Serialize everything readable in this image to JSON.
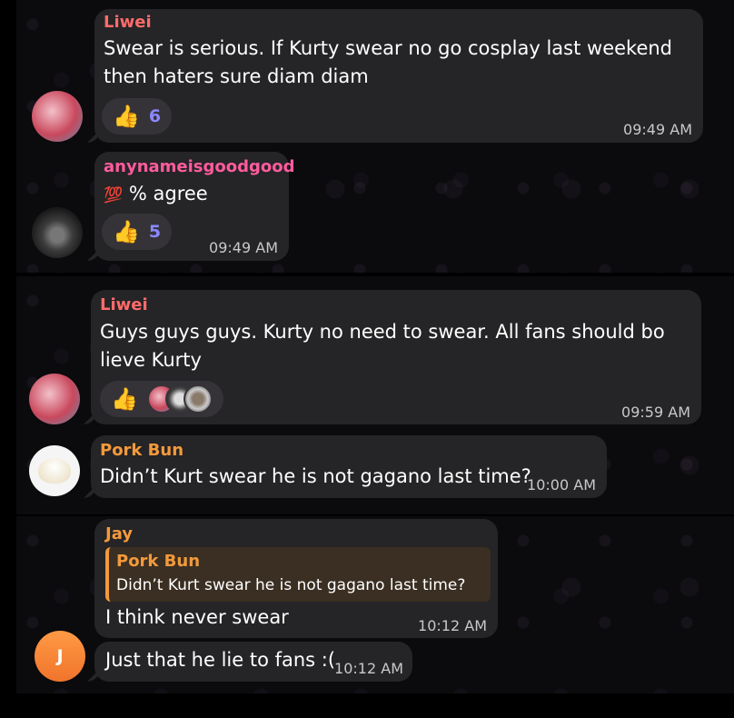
{
  "colors": {
    "liwei": "#ff6b6b",
    "anyname": "#ff5c9e",
    "porkbun": "#f39a3c",
    "jay": "#f39a3c",
    "count": "#8b88ff"
  },
  "messages": [
    {
      "sender": "Liwei",
      "lines": [
        "Swear is serious. If Kurty swear no go cosplay last weekend",
        "then haters sure diam diam"
      ],
      "reaction_icon": "thumbs-up-emoji",
      "reaction_count": "6",
      "time": "09:49 AM"
    },
    {
      "sender": "anynameisgoodgood",
      "emoji": "💯",
      "text": "% agree",
      "reaction_icon": "thumbs-up-emoji",
      "reaction_count": "5",
      "time": "09:49 AM"
    },
    {
      "sender": "Liwei",
      "lines": [
        "Guys guys guys. Kurty no need to swear. All fans should bo",
        "lieve Kurty"
      ],
      "reaction_icon": "thumbs-up-emoji",
      "time": "09:59 AM"
    },
    {
      "sender": "Pork Bun",
      "text": "Didn’t Kurt swear he is not gagano last time?",
      "time": "10:00 AM"
    },
    {
      "sender": "Jay",
      "reply_to": "Pork Bun",
      "reply_text": "Didn’t Kurt swear he is not gagano last time?",
      "text": "I think never swear",
      "time": "10:12 AM"
    },
    {
      "text": "Just that he lie to fans :(",
      "time": "10:12 AM"
    }
  ],
  "avatars": {
    "jay_initial": "J"
  }
}
